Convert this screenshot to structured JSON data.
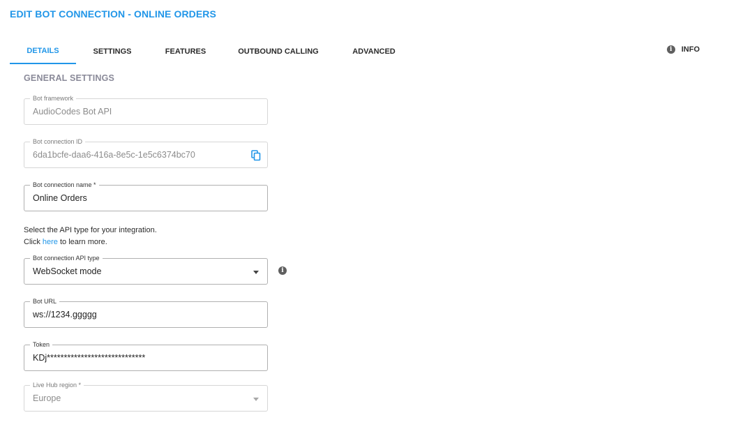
{
  "page": {
    "title": "EDIT BOT CONNECTION - ONLINE ORDERS"
  },
  "tabs": [
    {
      "label": "DETAILS",
      "active": true
    },
    {
      "label": "SETTINGS",
      "active": false
    },
    {
      "label": "FEATURES",
      "active": false
    },
    {
      "label": "OUTBOUND CALLING",
      "active": false
    },
    {
      "label": "ADVANCED",
      "active": false
    }
  ],
  "info_tab": {
    "label": "INFO",
    "icon": "info-icon"
  },
  "section": {
    "title": "GENERAL SETTINGS"
  },
  "fields": {
    "bot_framework": {
      "label": "Bot framework",
      "value": "AudioCodes Bot API",
      "disabled": true
    },
    "bot_connection_id": {
      "label": "Bot connection ID",
      "value": "6da1bcfe-daa6-416a-8e5c-1e5c6374bc70",
      "disabled": true,
      "action_icon": "copy-icon"
    },
    "bot_connection_name": {
      "label": "Bot connection name *",
      "value": "Online Orders"
    },
    "api_type": {
      "label": "Bot connection API type",
      "value": "WebSocket mode",
      "icon": "chevron-down-icon",
      "help_icon": "info-icon"
    },
    "bot_url": {
      "label": "Bot URL",
      "value": "ws://1234.ggggg"
    },
    "token": {
      "label": "Token",
      "value": "KDj*****************************"
    },
    "live_hub_region": {
      "label": "Live Hub region *",
      "value": "Europe",
      "disabled": true,
      "icon": "chevron-down-icon"
    }
  },
  "help": {
    "line1": "Select the API type for your integration.",
    "line2_prefix": "Click ",
    "line2_link": "here",
    "line2_suffix": " to learn more."
  },
  "colors": {
    "accent": "#2196e8",
    "section_title": "#8a8a99",
    "border": "#b0b0b0",
    "border_disabled": "#d6d6d6",
    "icon": "#5f5f5f"
  }
}
